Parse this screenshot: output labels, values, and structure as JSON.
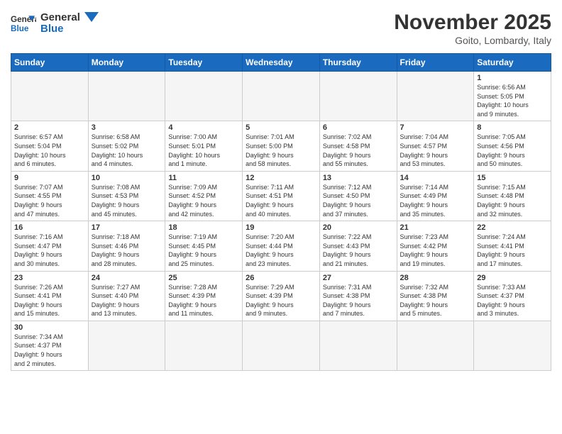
{
  "header": {
    "logo_general": "General",
    "logo_blue": "Blue",
    "month_title": "November 2025",
    "subtitle": "Goito, Lombardy, Italy"
  },
  "weekdays": [
    "Sunday",
    "Monday",
    "Tuesday",
    "Wednesday",
    "Thursday",
    "Friday",
    "Saturday"
  ],
  "weeks": [
    [
      {
        "day": "",
        "info": "",
        "empty": true
      },
      {
        "day": "",
        "info": "",
        "empty": true
      },
      {
        "day": "",
        "info": "",
        "empty": true
      },
      {
        "day": "",
        "info": "",
        "empty": true
      },
      {
        "day": "",
        "info": "",
        "empty": true
      },
      {
        "day": "",
        "info": "",
        "empty": true
      },
      {
        "day": "1",
        "info": "Sunrise: 6:56 AM\nSunset: 5:05 PM\nDaylight: 10 hours\nand 9 minutes."
      }
    ],
    [
      {
        "day": "2",
        "info": "Sunrise: 6:57 AM\nSunset: 5:04 PM\nDaylight: 10 hours\nand 6 minutes."
      },
      {
        "day": "3",
        "info": "Sunrise: 6:58 AM\nSunset: 5:02 PM\nDaylight: 10 hours\nand 4 minutes."
      },
      {
        "day": "4",
        "info": "Sunrise: 7:00 AM\nSunset: 5:01 PM\nDaylight: 10 hours\nand 1 minute."
      },
      {
        "day": "5",
        "info": "Sunrise: 7:01 AM\nSunset: 5:00 PM\nDaylight: 9 hours\nand 58 minutes."
      },
      {
        "day": "6",
        "info": "Sunrise: 7:02 AM\nSunset: 4:58 PM\nDaylight: 9 hours\nand 55 minutes."
      },
      {
        "day": "7",
        "info": "Sunrise: 7:04 AM\nSunset: 4:57 PM\nDaylight: 9 hours\nand 53 minutes."
      },
      {
        "day": "8",
        "info": "Sunrise: 7:05 AM\nSunset: 4:56 PM\nDaylight: 9 hours\nand 50 minutes."
      }
    ],
    [
      {
        "day": "9",
        "info": "Sunrise: 7:07 AM\nSunset: 4:55 PM\nDaylight: 9 hours\nand 47 minutes."
      },
      {
        "day": "10",
        "info": "Sunrise: 7:08 AM\nSunset: 4:53 PM\nDaylight: 9 hours\nand 45 minutes."
      },
      {
        "day": "11",
        "info": "Sunrise: 7:09 AM\nSunset: 4:52 PM\nDaylight: 9 hours\nand 42 minutes."
      },
      {
        "day": "12",
        "info": "Sunrise: 7:11 AM\nSunset: 4:51 PM\nDaylight: 9 hours\nand 40 minutes."
      },
      {
        "day": "13",
        "info": "Sunrise: 7:12 AM\nSunset: 4:50 PM\nDaylight: 9 hours\nand 37 minutes."
      },
      {
        "day": "14",
        "info": "Sunrise: 7:14 AM\nSunset: 4:49 PM\nDaylight: 9 hours\nand 35 minutes."
      },
      {
        "day": "15",
        "info": "Sunrise: 7:15 AM\nSunset: 4:48 PM\nDaylight: 9 hours\nand 32 minutes."
      }
    ],
    [
      {
        "day": "16",
        "info": "Sunrise: 7:16 AM\nSunset: 4:47 PM\nDaylight: 9 hours\nand 30 minutes."
      },
      {
        "day": "17",
        "info": "Sunrise: 7:18 AM\nSunset: 4:46 PM\nDaylight: 9 hours\nand 28 minutes."
      },
      {
        "day": "18",
        "info": "Sunrise: 7:19 AM\nSunset: 4:45 PM\nDaylight: 9 hours\nand 25 minutes."
      },
      {
        "day": "19",
        "info": "Sunrise: 7:20 AM\nSunset: 4:44 PM\nDaylight: 9 hours\nand 23 minutes."
      },
      {
        "day": "20",
        "info": "Sunrise: 7:22 AM\nSunset: 4:43 PM\nDaylight: 9 hours\nand 21 minutes."
      },
      {
        "day": "21",
        "info": "Sunrise: 7:23 AM\nSunset: 4:42 PM\nDaylight: 9 hours\nand 19 minutes."
      },
      {
        "day": "22",
        "info": "Sunrise: 7:24 AM\nSunset: 4:41 PM\nDaylight: 9 hours\nand 17 minutes."
      }
    ],
    [
      {
        "day": "23",
        "info": "Sunrise: 7:26 AM\nSunset: 4:41 PM\nDaylight: 9 hours\nand 15 minutes."
      },
      {
        "day": "24",
        "info": "Sunrise: 7:27 AM\nSunset: 4:40 PM\nDaylight: 9 hours\nand 13 minutes."
      },
      {
        "day": "25",
        "info": "Sunrise: 7:28 AM\nSunset: 4:39 PM\nDaylight: 9 hours\nand 11 minutes."
      },
      {
        "day": "26",
        "info": "Sunrise: 7:29 AM\nSunset: 4:39 PM\nDaylight: 9 hours\nand 9 minutes."
      },
      {
        "day": "27",
        "info": "Sunrise: 7:31 AM\nSunset: 4:38 PM\nDaylight: 9 hours\nand 7 minutes."
      },
      {
        "day": "28",
        "info": "Sunrise: 7:32 AM\nSunset: 4:38 PM\nDaylight: 9 hours\nand 5 minutes."
      },
      {
        "day": "29",
        "info": "Sunrise: 7:33 AM\nSunset: 4:37 PM\nDaylight: 9 hours\nand 3 minutes."
      }
    ],
    [
      {
        "day": "30",
        "info": "Sunrise: 7:34 AM\nSunset: 4:37 PM\nDaylight: 9 hours\nand 2 minutes."
      },
      {
        "day": "",
        "info": "",
        "empty": true
      },
      {
        "day": "",
        "info": "",
        "empty": true
      },
      {
        "day": "",
        "info": "",
        "empty": true
      },
      {
        "day": "",
        "info": "",
        "empty": true
      },
      {
        "day": "",
        "info": "",
        "empty": true
      },
      {
        "day": "",
        "info": "",
        "empty": true
      }
    ]
  ]
}
